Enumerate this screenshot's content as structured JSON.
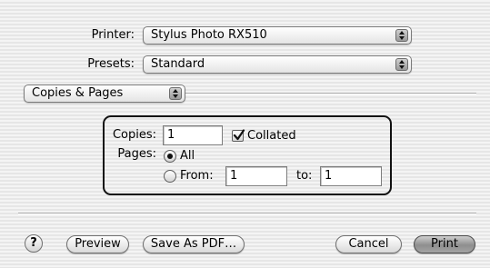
{
  "printer": {
    "label": "Printer:",
    "value": "Stylus Photo RX510"
  },
  "presets": {
    "label": "Presets:",
    "value": "Standard"
  },
  "panel": {
    "value": "Copies & Pages"
  },
  "copies": {
    "label": "Copies:",
    "value": "1",
    "collated_label": "Collated",
    "collated_checked": true
  },
  "pages": {
    "label": "Pages:",
    "all_label": "All",
    "all_selected": true,
    "from_label": "From:",
    "from_value": "1",
    "to_label": "to:",
    "to_value": "1"
  },
  "buttons": {
    "help": "?",
    "preview": "Preview",
    "save_pdf": "Save As PDF…",
    "cancel": "Cancel",
    "print": "Print"
  },
  "icons": {
    "popup_arrows": "up-down-arrows-icon",
    "checkmark": "checkmark-icon",
    "radio_dot": "radio-dot-icon"
  }
}
